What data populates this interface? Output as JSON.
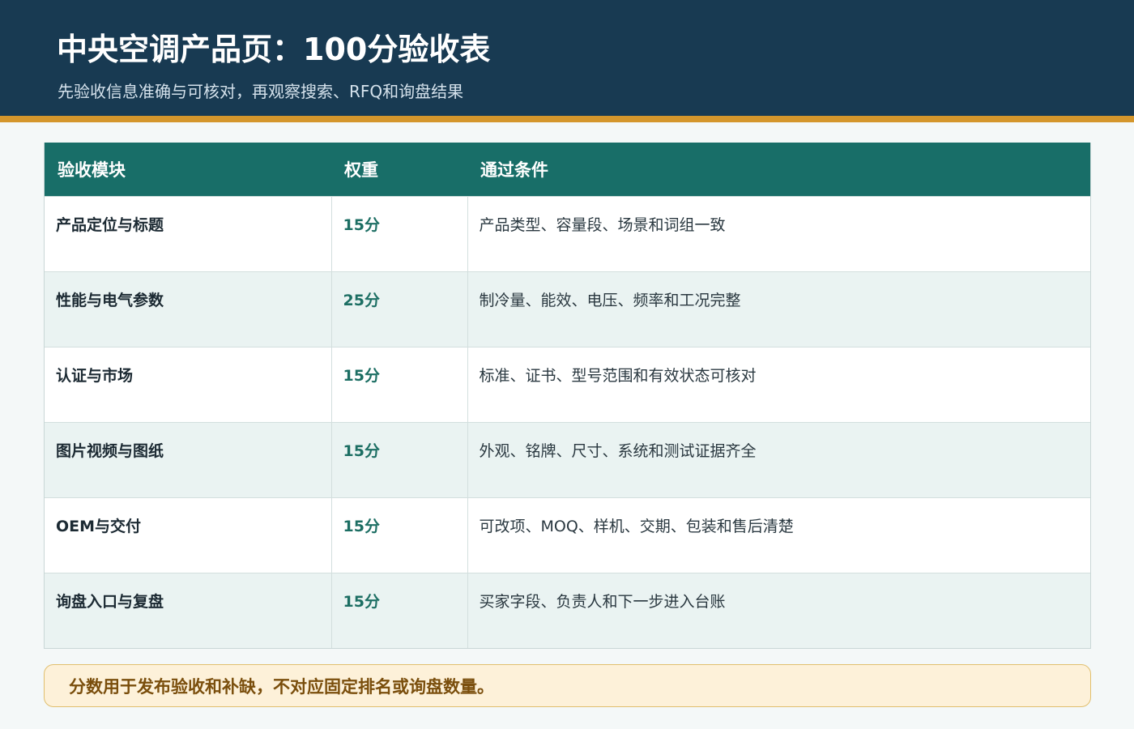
{
  "header": {
    "title": "中央空调产品页：100分验收表",
    "subtitle": "先验收信息准确与可核对，再观察搜索、RFQ和询盘结果"
  },
  "table": {
    "columns": [
      "验收模块",
      "权重",
      "通过条件"
    ],
    "rows": [
      {
        "module": "产品定位与标题",
        "weight": "15分",
        "condition": "产品类型、容量段、场景和词组一致"
      },
      {
        "module": "性能与电气参数",
        "weight": "25分",
        "condition": "制冷量、能效、电压、频率和工况完整"
      },
      {
        "module": "认证与市场",
        "weight": "15分",
        "condition": "标准、证书、型号范围和有效状态可核对"
      },
      {
        "module": "图片视频与图纸",
        "weight": "15分",
        "condition": "外观、铭牌、尺寸、系统和测试证据齐全"
      },
      {
        "module": "OEM与交付",
        "weight": "15分",
        "condition": "可改项、MOQ、样机、交期、包装和售后清楚"
      },
      {
        "module": "询盘入口与复盘",
        "weight": "15分",
        "condition": "买家字段、负责人和下一步进入台账"
      }
    ]
  },
  "note": "分数用于发布验收和补缺，不对应固定排名或询盘数量。",
  "colors": {
    "header_bg": "#183a52",
    "accent_rule": "#d4962c",
    "table_header_bg": "#186e68",
    "weight_text": "#1c6e63",
    "note_bg": "#fdf1d9",
    "note_text": "#7a4e0c"
  }
}
